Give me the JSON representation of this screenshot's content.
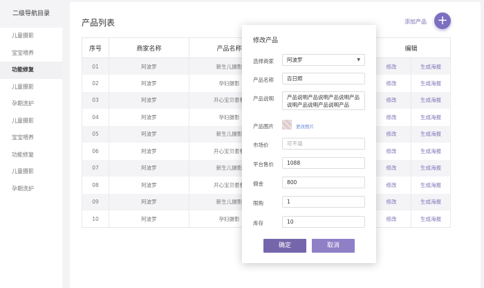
{
  "sidebar": {
    "title": "二级导航目录",
    "items": [
      {
        "label": "儿童摄影",
        "active": false
      },
      {
        "label": "宝宝喂养",
        "active": false
      },
      {
        "label": "功能修复",
        "active": true
      },
      {
        "label": "儿童摄影",
        "active": false
      },
      {
        "label": "孕期洗护",
        "active": false
      },
      {
        "label": "儿童摄影",
        "active": false
      },
      {
        "label": "宝宝喂养",
        "active": false
      },
      {
        "label": "功能修复",
        "active": false
      },
      {
        "label": "儿童摄影",
        "active": false
      },
      {
        "label": "孕期洗护",
        "active": false
      }
    ]
  },
  "header": {
    "title": "产品列表",
    "add_label": "添加产品",
    "add_symbol": "+"
  },
  "table": {
    "columns": [
      "序号",
      "商家名称",
      "产品名称",
      "编辑"
    ],
    "rows": [
      {
        "no": "01",
        "merchant": "阿波罗",
        "product": "新生儿摄影",
        "edit": "修改",
        "poster": "生成海报"
      },
      {
        "no": "02",
        "merchant": "阿波罗",
        "product": "孕妇摄影",
        "edit": "修改",
        "poster": "生成海报"
      },
      {
        "no": "03",
        "merchant": "阿波罗",
        "product": "开心宝贝套餐",
        "edit": "修改",
        "poster": "生成海报"
      },
      {
        "no": "04",
        "merchant": "阿波罗",
        "product": "孕妇摄影",
        "edit": "修改",
        "poster": "生成海报"
      },
      {
        "no": "05",
        "merchant": "阿波罗",
        "product": "新生儿摄影",
        "edit": "修改",
        "poster": "生成海报"
      },
      {
        "no": "06",
        "merchant": "阿波罗",
        "product": "开心宝贝套餐",
        "edit": "修改",
        "poster": "生成海报"
      },
      {
        "no": "07",
        "merchant": "阿波罗",
        "product": "新生儿摄影",
        "edit": "修改",
        "poster": "生成海报"
      },
      {
        "no": "08",
        "merchant": "阿波罗",
        "product": "开心宝贝套餐",
        "edit": "修改",
        "poster": "生成海报"
      },
      {
        "no": "09",
        "merchant": "阿波罗",
        "product": "新生儿摄影",
        "edit": "修改",
        "poster": "生成海报"
      },
      {
        "no": "10",
        "merchant": "阿波罗",
        "product": "孕妇摄影",
        "edit": "修改",
        "poster": "生成海报"
      }
    ]
  },
  "dialog": {
    "title": "修改产品",
    "merchant_label": "选择商家",
    "merchant_value": "阿波罗",
    "name_label": "产品名称",
    "name_value": "百日照",
    "desc_label": "产品说明",
    "desc_value": "产品说明产品说明产品说明产品说明产品说明产品说明产品",
    "image_label": "产品图片",
    "image_link": "更改图片",
    "market_label": "市场价",
    "market_placeholder": "可不填",
    "price_label": "平台售价",
    "price_value": "1088",
    "commission_label": "佣金",
    "commission_value": "800",
    "limit_label": "限购",
    "limit_value": "1",
    "stock_label": "库存",
    "stock_value": "10",
    "ok_label": "确定",
    "cancel_label": "取消"
  },
  "colors": {
    "accent": "#7d6fc0",
    "link": "#7b6fb6",
    "ok_button": "#7566ac",
    "cancel_button": "#8f7fc7"
  }
}
